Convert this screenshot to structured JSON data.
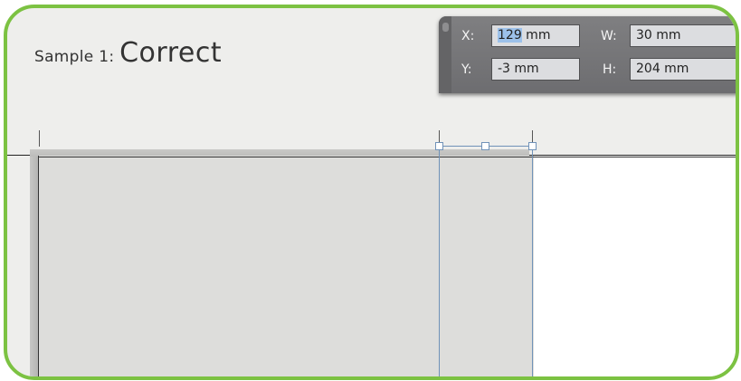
{
  "caption": {
    "prefix": "Sample 1: ",
    "word": "Correct"
  },
  "palette": {
    "x_label": "X:",
    "x_value_selected": "129",
    "x_value_rest": " mm",
    "y_label": "Y:",
    "y_value": "-3 mm",
    "w_label": "W:",
    "w_value": "30 mm",
    "h_label": "H:",
    "h_value": "204 mm"
  },
  "colors": {
    "frame_border": "#7cc242",
    "selection": "#7092b8",
    "text_highlight": "#9cc1ea"
  }
}
